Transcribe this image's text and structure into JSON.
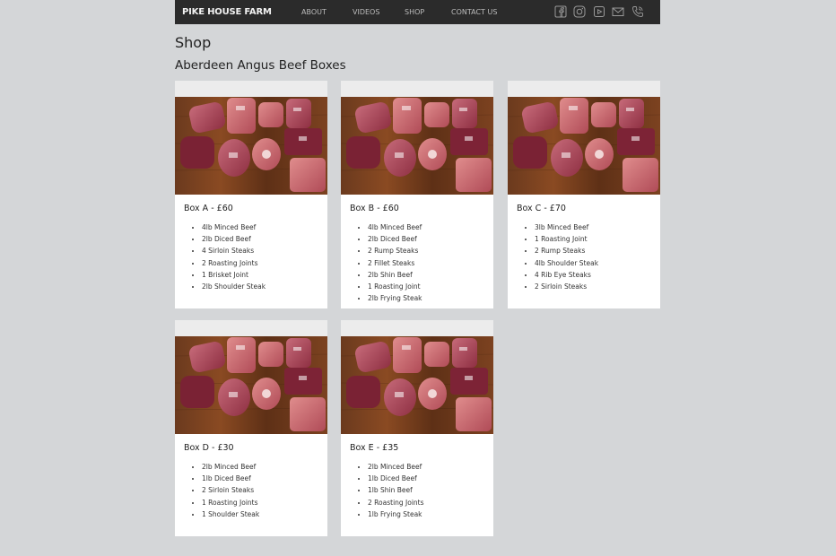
{
  "nav": {
    "brand": "PIKE HOUSE FARM",
    "links": [
      "ABOUT",
      "VIDEOS",
      "SHOP",
      "CONTACT US"
    ],
    "icons": [
      "facebook-icon",
      "instagram-icon",
      "youtube-icon",
      "email-icon",
      "phone-icon"
    ]
  },
  "page": {
    "title": "Shop",
    "section": "Aberdeen Angus Beef Boxes"
  },
  "boxes": [
    {
      "title": "Box A - £60",
      "items": [
        "4lb Minced Beef",
        "2lb Diced Beef",
        "4 Sirloin Steaks",
        "2 Roasting Joints",
        "1 Brisket Joint",
        "2lb Shoulder Steak"
      ]
    },
    {
      "title": "Box B - £60",
      "items": [
        "4lb Minced Beef",
        "2lb Diced Beef",
        "2 Rump Steaks",
        "2 Fillet Steaks",
        "2lb Shin Beef",
        "1 Roasting Joint",
        "2lb Frying Steak"
      ]
    },
    {
      "title": "Box C - £70",
      "items": [
        "3lb Minced Beef",
        "1 Roasting Joint",
        "2 Rump Steaks",
        "4lb Shoulder Steak",
        "4 Rib Eye Steaks",
        "2 Sirloin Steaks"
      ]
    },
    {
      "title": "Box D - £30",
      "items": [
        "2lb Minced Beef",
        "1lb Diced Beef",
        "2 Sirloin Steaks",
        "1 Roasting Joints",
        "1 Shoulder Steak"
      ]
    },
    {
      "title": "Box E - £35",
      "items": [
        "2lb Minced Beef",
        "1lb Diced Beef",
        "1lb Shin Beef",
        "2 Roasting Joints",
        "1lb Frying Steak"
      ]
    }
  ],
  "colors": {
    "navbar": "#2b2b2b",
    "background": "#d4d6d8",
    "card": "#ffffff"
  }
}
